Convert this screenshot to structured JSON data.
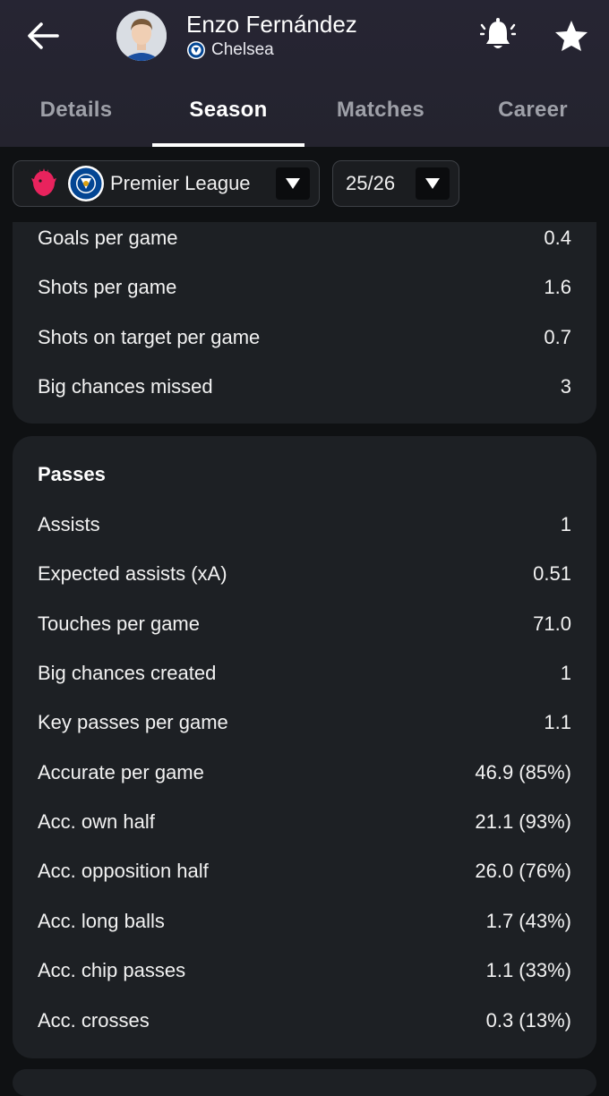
{
  "player": {
    "name": "Enzo Fernández",
    "club": "Chelsea"
  },
  "tabs": [
    {
      "label": "Details"
    },
    {
      "label": "Season"
    },
    {
      "label": "Matches"
    },
    {
      "label": "Career"
    }
  ],
  "active_tab": "Season",
  "filters": {
    "league": "Premier League",
    "season": "25/26"
  },
  "shooting_stats": [
    {
      "label": "Goals per game",
      "value": "0.4"
    },
    {
      "label": "Shots per game",
      "value": "1.6"
    },
    {
      "label": "Shots on target per game",
      "value": "0.7"
    },
    {
      "label": "Big chances missed",
      "value": "3"
    }
  ],
  "passes": {
    "title": "Passes",
    "stats": [
      {
        "label": "Assists",
        "value": "1"
      },
      {
        "label": "Expected assists (xA)",
        "value": "0.51"
      },
      {
        "label": "Touches per game",
        "value": "71.0"
      },
      {
        "label": "Big chances created",
        "value": "1"
      },
      {
        "label": "Key passes per game",
        "value": "1.1"
      },
      {
        "label": "Accurate per game",
        "value": "46.9 (85%)"
      },
      {
        "label": "Acc. own half",
        "value": "21.1 (93%)"
      },
      {
        "label": "Acc. opposition half",
        "value": "26.0 (76%)"
      },
      {
        "label": "Acc. long balls",
        "value": "1.7 (43%)"
      },
      {
        "label": "Acc. chip passes",
        "value": "1.1 (33%)"
      },
      {
        "label": "Acc. crosses",
        "value": "0.3 (13%)"
      }
    ]
  },
  "icons": {
    "back": "arrow-left-icon",
    "bell": "bell-ringing-icon",
    "star": "star-icon",
    "league_logo": "premier-league-logo",
    "club_logo": "chelsea-crest"
  },
  "colors": {
    "header_bg": "#252431",
    "card_bg": "#1d2024",
    "page_bg": "#0f1113",
    "pl_logo": "#e8235d",
    "chelsea_blue": "#034694"
  }
}
